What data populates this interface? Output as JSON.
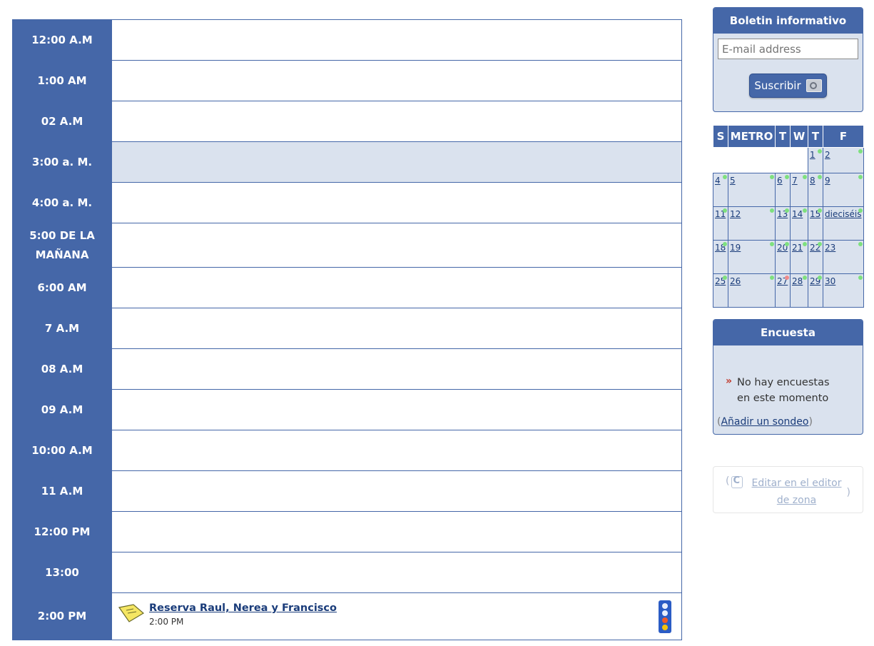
{
  "schedule": {
    "hours": [
      {
        "label": "12:00 A.M"
      },
      {
        "label": "1:00 AM"
      },
      {
        "label": "02 A.M"
      },
      {
        "label": "3:00 a. M.",
        "current": true
      },
      {
        "label": "4:00 a. M."
      },
      {
        "label": "5:00 DE LA MAÑANA"
      },
      {
        "label": "6:00 AM"
      },
      {
        "label": "7 A.M"
      },
      {
        "label": "08 A.M"
      },
      {
        "label": "09 A.M"
      },
      {
        "label": "10:00 A.M"
      },
      {
        "label": "11 A.M"
      },
      {
        "label": "12:00 PM"
      },
      {
        "label": "13:00"
      },
      {
        "label": "2:00 PM",
        "event": {
          "title": "Reserva Raul, Nerea y Francisco",
          "time": "2:00 PM"
        }
      }
    ]
  },
  "newsletter": {
    "title": "Boletin informativo",
    "email_placeholder": "E-mail address",
    "subscribe_label": "Suscribir"
  },
  "calendar": {
    "headers": [
      "S",
      "METRO",
      "T",
      "W",
      "T",
      "F"
    ],
    "weeks": [
      [
        null,
        null,
        null,
        null,
        "1",
        "2"
      ],
      [
        "4",
        "5",
        "6",
        "7",
        "8",
        "9"
      ],
      [
        "11",
        "12",
        "13",
        "14",
        "15",
        "dieciséis"
      ],
      [
        "18",
        "19",
        "20",
        "21",
        "22",
        "23"
      ],
      [
        "25",
        "26",
        "27",
        "28",
        "29",
        "30"
      ]
    ],
    "marked_red_day": "27"
  },
  "poll": {
    "title": "Encuesta",
    "message": "No hay encuestas en este momento",
    "paren_open": "(",
    "add_link": "Añadir un sondeo",
    "paren_close": ")"
  },
  "zone_editor": {
    "paren_open": "(",
    "link": "Editar en el editor de zona",
    "paren_close": ")"
  },
  "colors": {
    "header_blue": "#4567a8",
    "light_panel": "#dae2ee",
    "link_blue": "#1a3c7a"
  }
}
